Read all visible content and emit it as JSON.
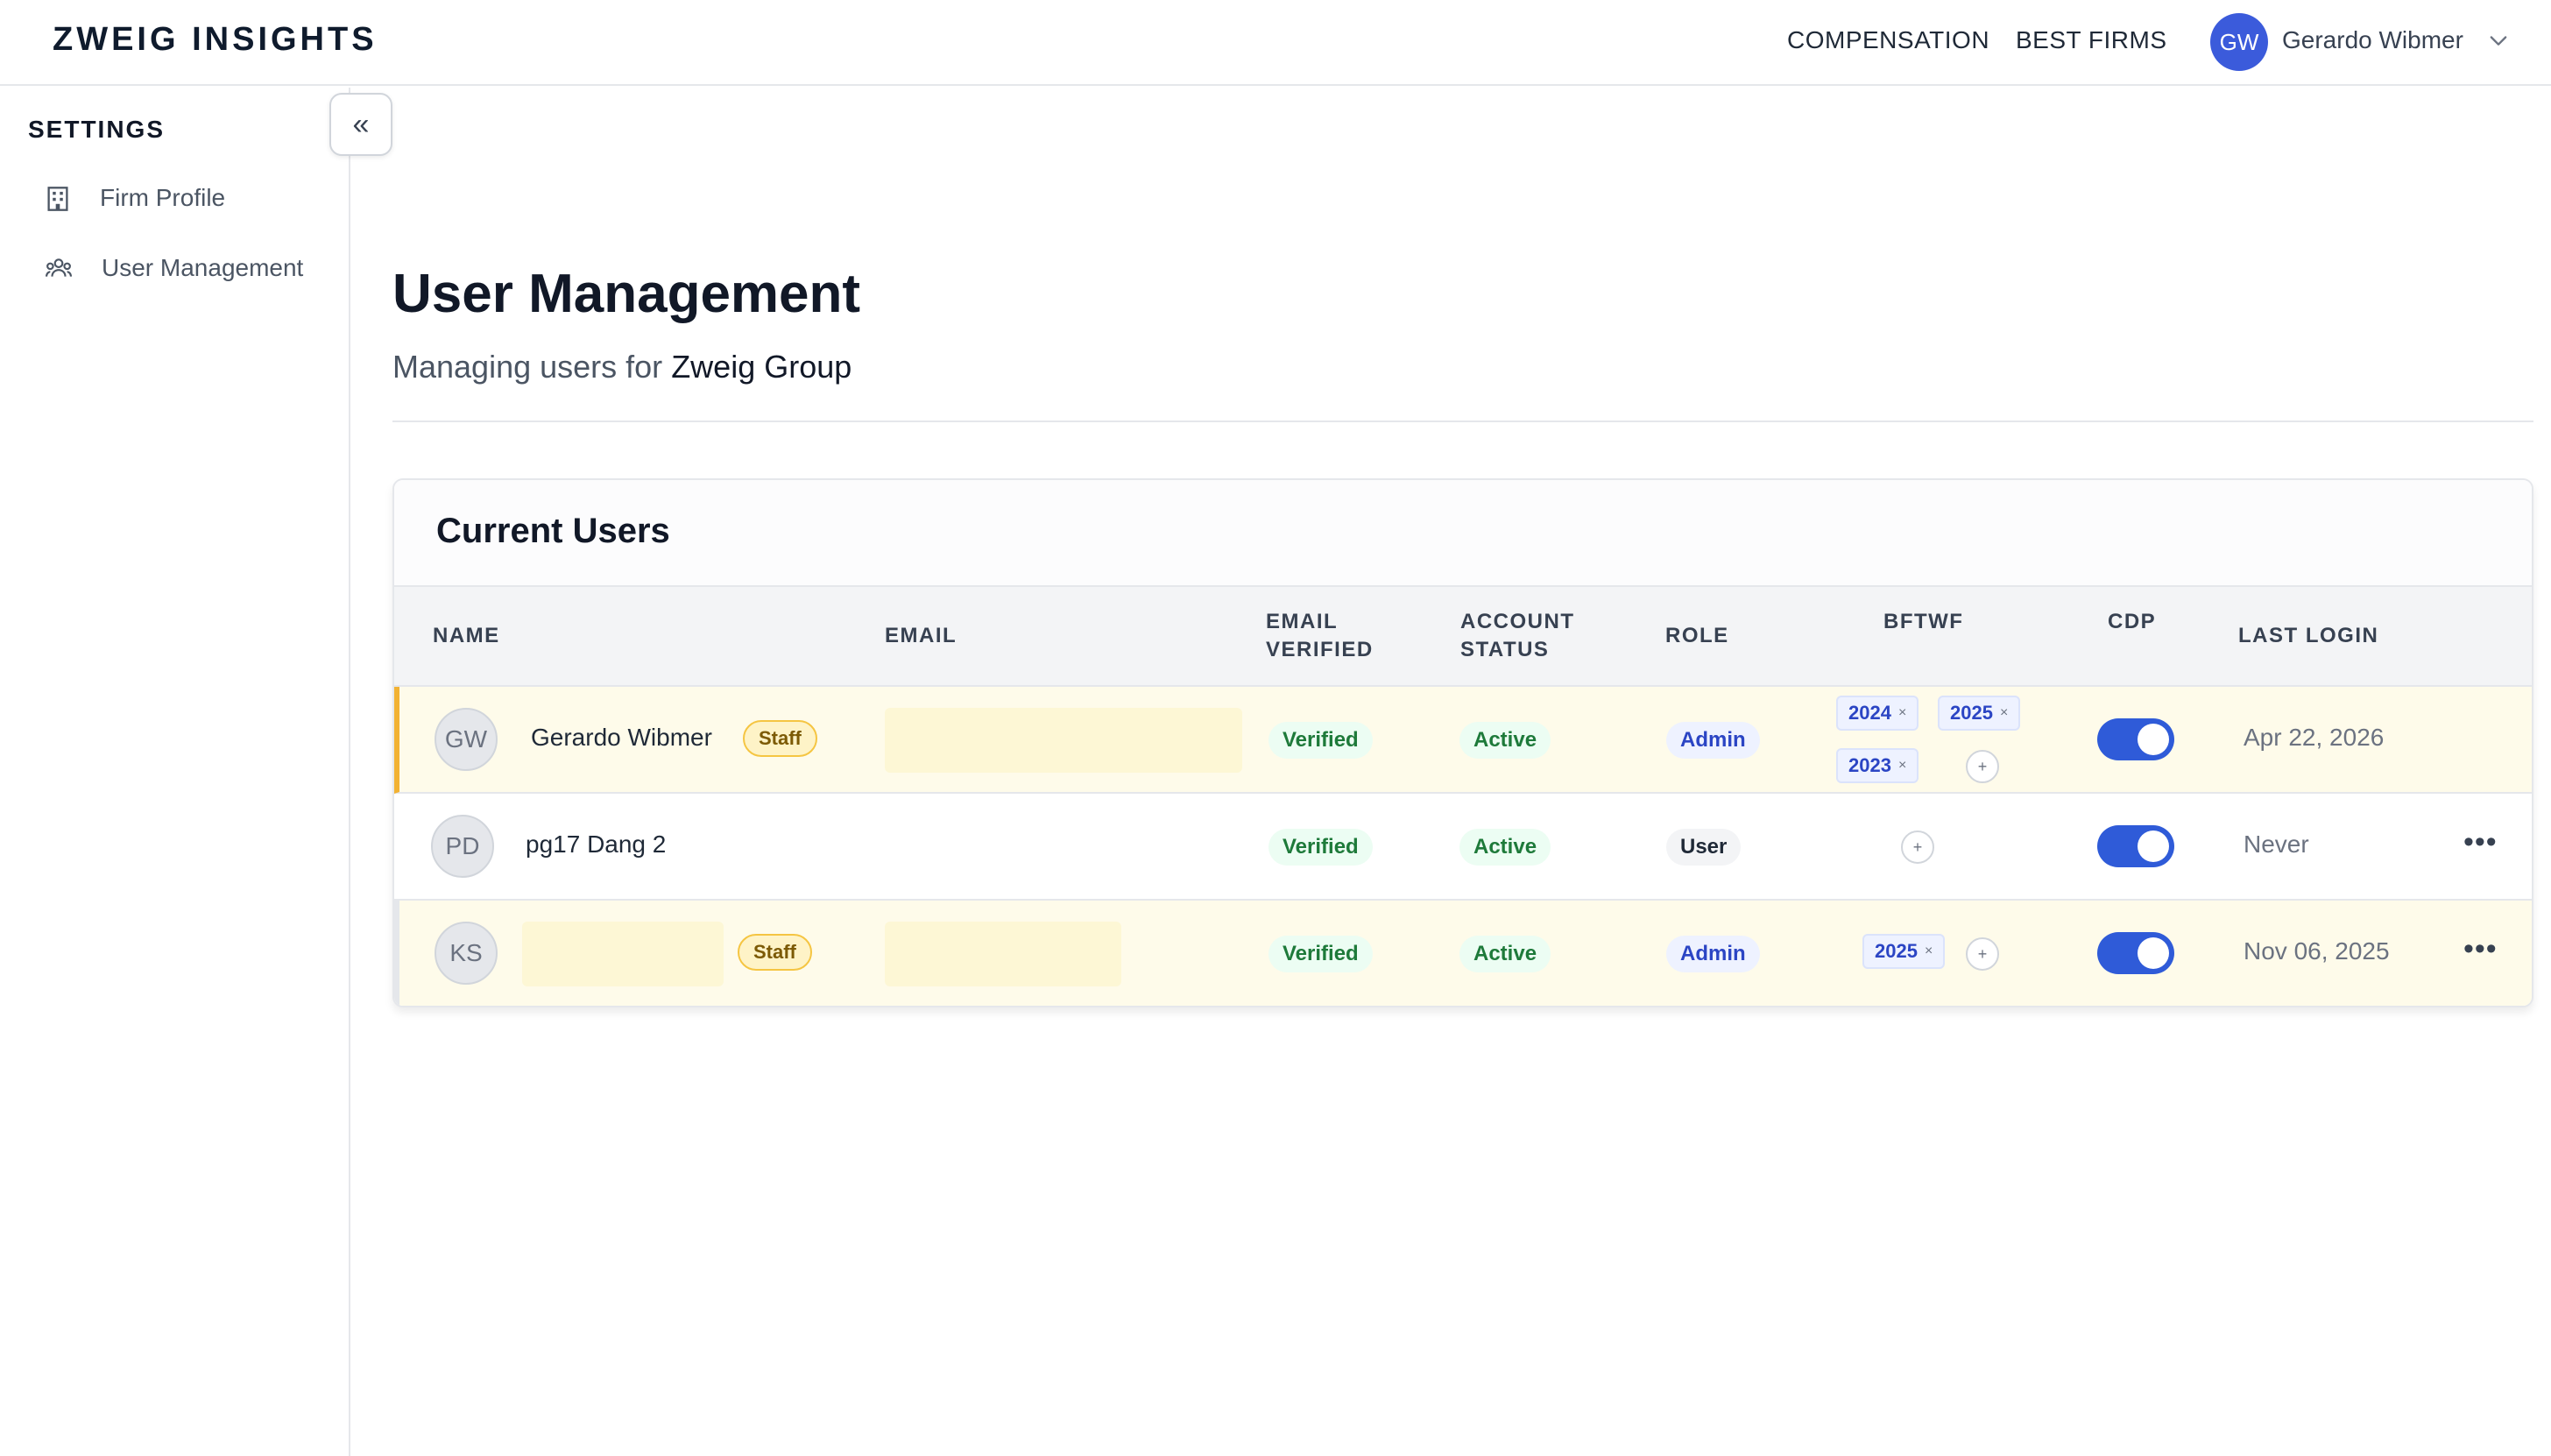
{
  "header": {
    "logo": "ZWEIG INSIGHTS",
    "nav": [
      "COMPENSATION",
      "BEST FIRMS"
    ],
    "user": {
      "initials": "GW",
      "name": "Gerardo Wibmer"
    }
  },
  "sidebar": {
    "title": "SETTINGS",
    "items": [
      {
        "label": "Firm Profile",
        "icon": "building-icon"
      },
      {
        "label": "User Management",
        "icon": "users-icon"
      }
    ],
    "collapse_glyph": "«"
  },
  "main": {
    "title": "User Management",
    "subtitle_prefix": "Managing users for",
    "firm_name": "Zweig Group"
  },
  "users_card": {
    "title": "Current Users",
    "columns": {
      "name": "NAME",
      "email": "EMAIL",
      "email_verified": "EMAIL VERIFIED",
      "account_status": "ACCOUNT STATUS",
      "role": "ROLE",
      "bftwf": "BFTWF",
      "cdp": "CDP",
      "last_login": "LAST LOGIN"
    },
    "rows": [
      {
        "initials": "GW",
        "name": "Gerardo Wibmer",
        "badge": "Staff",
        "email_verified": "Verified",
        "status": "Active",
        "role": "Admin",
        "years": [
          "2024",
          "2025",
          "2023"
        ],
        "cdp_enabled": true,
        "last_login": "Apr 22, 2026"
      },
      {
        "initials": "PD",
        "name": "pg17 Dang 2",
        "badge": "",
        "email_verified": "Verified",
        "status": "Active",
        "role": "User",
        "years": [],
        "cdp_enabled": true,
        "last_login": "Never"
      },
      {
        "initials": "KS",
        "name": "",
        "badge": "Staff",
        "email_verified": "Verified",
        "status": "Active",
        "role": "Admin",
        "years": [
          "2025"
        ],
        "cdp_enabled": true,
        "last_login": "Nov 06, 2025"
      }
    ],
    "remove_glyph": "×",
    "add_glyph": "+",
    "more_glyph": "•••"
  },
  "colors": {
    "brand_dark": "#0f1b2d",
    "accent_blue": "#2f5bd8",
    "staff_row_bg": "#fefbea",
    "staff_accent": "#f2b233",
    "verified_green": "#1e7a3a"
  }
}
